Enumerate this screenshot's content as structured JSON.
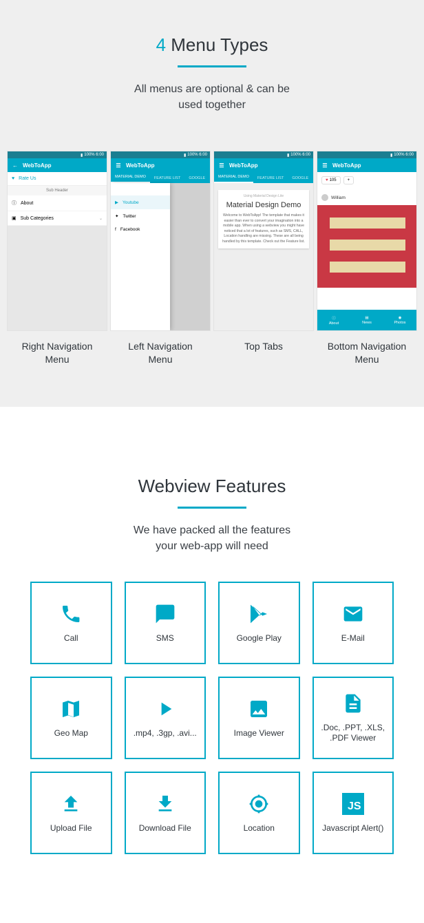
{
  "section1": {
    "title_num": "4",
    "title_rest": "Menu Types",
    "subtitle_l1": "All menus are optional & can be",
    "subtitle_l2": "used together",
    "shots": [
      {
        "caption_l1": "Right Navigation",
        "caption_l2": "Menu"
      },
      {
        "caption_l1": "Left Navigation",
        "caption_l2": "Menu"
      },
      {
        "caption_l1": "Top Tabs",
        "caption_l2": ""
      },
      {
        "caption_l1": "Bottom Navigation",
        "caption_l2": "Menu"
      }
    ],
    "phone": {
      "status_text": "100% 6:00",
      "app_title": "WebToApp",
      "rn": {
        "rate": "Rate Us",
        "sub_header": "Sub Header",
        "about": "About",
        "sub_cats": "Sub Categories"
      },
      "ln": {
        "yt": "Youtube",
        "tw": "Twitter",
        "fb": "Facebook"
      },
      "tabs": {
        "t1": "MATERIAL DEMO",
        "t2": "FEATURE LIST",
        "t3": "GOOGLE"
      },
      "md": {
        "crumb": "Using Material Design Lite",
        "heading": "Material Design Demo",
        "para": "Welcome to WebToApp! The template that makes it easier than ever to convert your imagination into a mobile app. When using a webview you might have noticed that a lot of features, such as SMS, CALL, Location handling are missing. These are all being handled by this template. Check out the Feature list."
      },
      "bn": {
        "likes": "105",
        "plus": "+",
        "user": "William",
        "b1": "About",
        "b2": "News",
        "b3": "Photos"
      }
    }
  },
  "section2": {
    "title": "Webview Features",
    "subtitle_l1": "We have packed all the features",
    "subtitle_l2": "your web-app will need",
    "features": [
      {
        "label": "Call"
      },
      {
        "label": "SMS"
      },
      {
        "label": "Google Play"
      },
      {
        "label": "E-Mail"
      },
      {
        "label": "Geo Map"
      },
      {
        "label": ".mp4, .3gp, .avi..."
      },
      {
        "label": "Image Viewer"
      },
      {
        "label": ".Doc, .PPT, .XLS, .PDF Viewer"
      },
      {
        "label": "Upload File"
      },
      {
        "label": "Download File"
      },
      {
        "label": "Location"
      },
      {
        "label": "Javascript Alert()"
      }
    ]
  }
}
